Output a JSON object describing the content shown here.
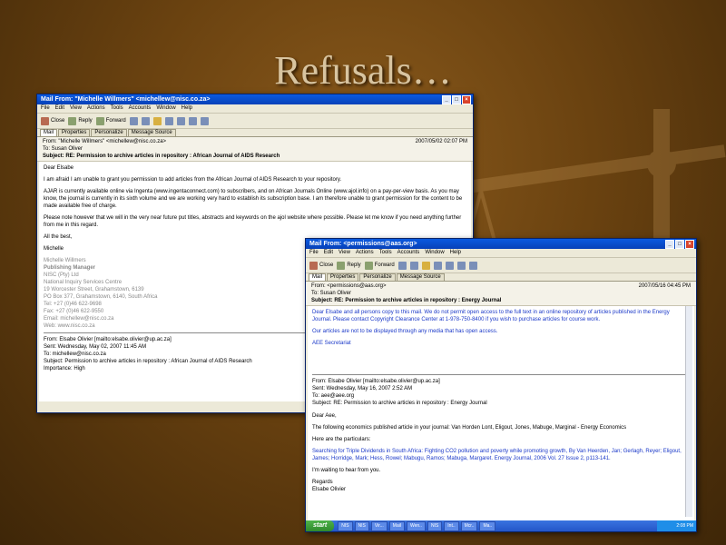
{
  "slide": {
    "title": "Refusals…"
  },
  "window1": {
    "title": "Mail From: \"Michelle Willmers\" <michellew@nisc.co.za>",
    "menu": [
      "File",
      "Edit",
      "View",
      "Actions",
      "Tools",
      "Accounts",
      "Window",
      "Help"
    ],
    "toolbar": [
      "Close",
      "Reply",
      "Forward"
    ],
    "tabs": [
      "Mail",
      "Properties",
      "Personalize",
      "Message Source"
    ],
    "from": "From: \"Michelle Willmers\" <michellew@nisc.co.za>",
    "to": "To: Susan Oliver",
    "subject": "Subject: RE: Permission to archive articles in repository : African Journal of AIDS Research",
    "date": "2007/05/02 02:07 PM",
    "greeting": "Dear Elsabe",
    "p1": "I am afraid I am unable to grant you permission to add articles from the African Journal of AIDS Research to your repository.",
    "p2": "AJAR is currently available online via Ingenta (www.ingentaconnect.com) to subscribers, and on African Journals Online (www.ajol.info) on a pay-per-view basis. As you may know, the journal is currently in its sixth volume and we are working very hard to establish its subscription base. I am therefore unable to grant permission for the content to be made available free of charge.",
    "p3": "Please note however that we will in the very near future put titles, abstracts and keywords on the ajol website where possible. Please let me know if you need anything further from me in this regard.",
    "p4": "All the best,",
    "p5": "Michelle",
    "sig": [
      "Michelle Willmers",
      "Publishing Manager",
      "",
      "NISC (Pty) Ltd",
      "National Inquiry Services Centre",
      "19 Worcester Street, Grahamstown, 6139",
      "PO Box 377, Grahamstown, 6140, South Africa",
      "Tel: +27 (0)46 622-9698",
      "Fax: +27 (0)46 622-9550",
      "Email: michellew@nisc.co.za",
      "Web: www.nisc.co.za"
    ],
    "q_from": "From: Elsabe Olivier [mailto:elsabe.olivier@up.ac.za]",
    "q_sent": "Sent: Wednesday, May 02, 2007 11:45 AM",
    "q_to": "To: michellew@nisc.co.za",
    "q_subject": "Subject: Permission to archive articles in repository : African Journal of AIDS Research",
    "q_importance": "Importance: High"
  },
  "window2": {
    "title": "Mail From: <permissions@aas.org>",
    "menu": [
      "File",
      "Edit",
      "View",
      "Actions",
      "Tools",
      "Accounts",
      "Window",
      "Help"
    ],
    "toolbar": [
      "Close",
      "Reply",
      "Forward"
    ],
    "tabs": [
      "Mail",
      "Properties",
      "Personalize",
      "Message Source"
    ],
    "from": "From: <permissions@aas.org>",
    "to": "To: Susan Oliver",
    "subject": "Subject: RE: Permission to archive articles in repository : Energy Journal",
    "date": "2007/05/16 04:45 PM",
    "l1": "Dear Elsabe and all persons copy to this mail. We do not permit open access to the full text in an online repository of articles published in the Energy Journal. Please contact Copyright Clearance Center at 1-978-750-8400 if you wish to purchase articles for course work.",
    "l2": "Our articles are not to be displayed through any media that has open access.",
    "l3": "AEE Secretariat",
    "q_from": "From: Elsabe Olivier [mailto:elsabe.olivier@up.ac.za]",
    "q_sent": "Sent: Wednesday, May 16, 2007 2:52 AM",
    "q_to": "To: aee@aee.org",
    "q_subject": "Subject: RE: Permission to archive articles in repository : Energy Journal",
    "q_greet": "Dear Aee,",
    "q_p1": "The following economics published article in your journal: Van Horden Lont, Eligout, Jones, Mabuge, Marginal - Energy Economics",
    "q_p2": "Here are the particulars:",
    "q_p3": "Searching for Triple Dividends in South Africa: Fighting CO2 pollution and poverty while promoting growth, By Van Heerden, Jan; Gerlagh, Reyer; Eligout, James; Horridge, Mark; Hess, Rowel; Mabugu, Ramos; Mabuga, Margaret. Energy Journal, 2006 Vol. 27 Issue 2, p113-141.",
    "q_p4": "I'm waiting to hear from you.",
    "q_p5": "Regards",
    "q_p6": "Elsabe Olivier",
    "taskbar": {
      "start": "start",
      "tasks": [
        "NIS",
        "NIS",
        "Vir...",
        "Mail",
        "Wen..",
        "NIS",
        "Int..",
        "Mcr..",
        "Ma..",
        "Mail",
        "NI"
      ],
      "clock": "2:08 PM"
    }
  }
}
